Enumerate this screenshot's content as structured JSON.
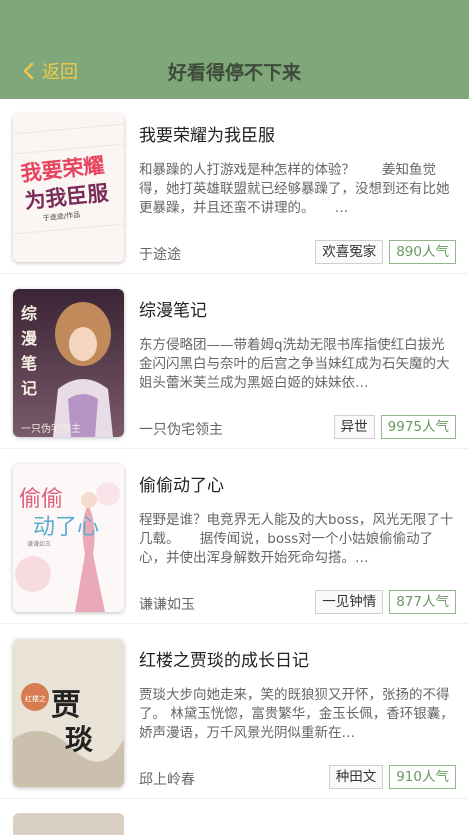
{
  "header": {
    "back_label": "返回",
    "title": "好看得停不下来",
    "bg_color": "#7fa77a",
    "back_color": "#f2c94c"
  },
  "books": [
    {
      "title": "我要荣耀为我臣服",
      "description": "和暴躁的人打游戏是种怎样的体验？　　姜知鱼觉得，她打英雄联盟就已经够暴躁了，没想到还有比她更暴躁，并且还蛮不讲理的。　　…",
      "author": "于途途",
      "category": "欢喜冤家",
      "popularity": "890人气",
      "cover_text": "我要荣耀为我臣服",
      "cover_subtext": "于途途/作品"
    },
    {
      "title": "综漫笔记",
      "description": "东方侵略团——带着姆q洗劫无限书库指使红白拔光金闪闪黑白与奈叶的后宫之争当妹红成为石矢魔的大姐头蕾米芙兰成为黑姬白姬的妹妹依…",
      "author": "一只伪宅领主",
      "category": "异世",
      "popularity": "9975人气",
      "cover_text": "综漫笔记",
      "cover_subtext": "一只伪宅领主"
    },
    {
      "title": "偷偷动了心",
      "description": "程野是谁？电竞界无人能及的大boss，风光无限了十几载。　　据传闻说，boss对一个小姑娘偷偷动了心，并使出浑身解数开始死命勾搭。…",
      "author": "谦谦如玉",
      "category": "一见钟情",
      "popularity": "877人气",
      "cover_text": "偷偷动了心",
      "cover_subtext": "谦谦如玉"
    },
    {
      "title": "红楼之贾琰的成长日记",
      "description": "贾琰大步向她走来，笑的既狼狈又开怀，张扬的不得了。 林黛玉恍惚，富贵繁华，金玉长佩，香环银囊，娇声漫语，万千风景光阴似重新在…",
      "author": "邱上岭春",
      "category": "种田文",
      "popularity": "910人气",
      "cover_text": "贾琰",
      "cover_subtext": "红楼之"
    }
  ]
}
